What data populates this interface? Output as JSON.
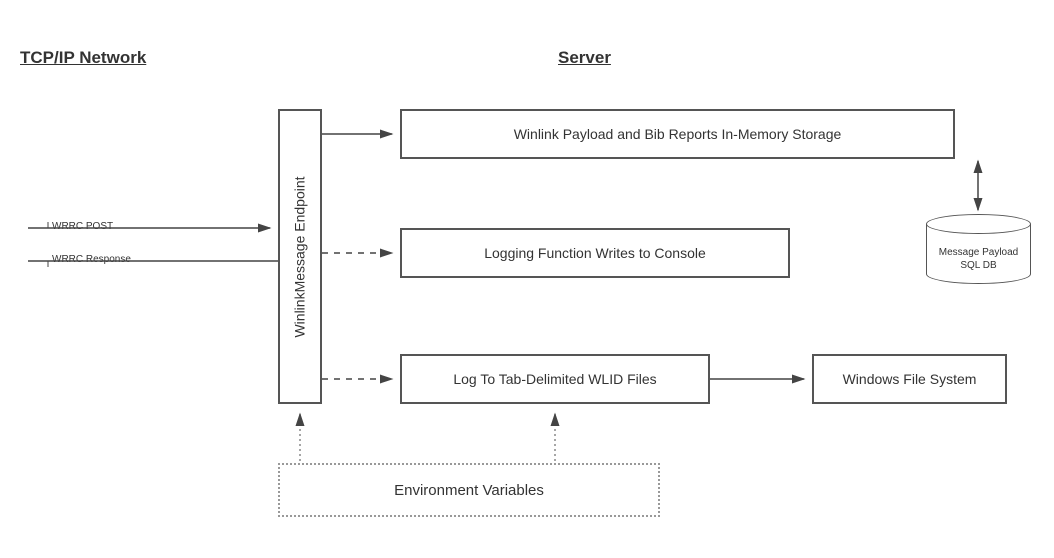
{
  "headings": {
    "network": "TCP/IP Network",
    "server": "Server"
  },
  "labels": {
    "wrrc_post": "WRRC POST",
    "wrrc_response": "WRRC Response"
  },
  "boxes": {
    "endpoint": "WinlinkMessage Endpoint",
    "storage": "Winlink Payload and Bib Reports In-Memory Storage",
    "logging": "Logging Function Writes to Console",
    "logfiles": "Log To Tab-Delimited WLID Files",
    "filesystem": "Windows File System",
    "envvars": "Environment Variables"
  },
  "database": {
    "line1": "Message Payload",
    "line2": "SQL DB"
  }
}
